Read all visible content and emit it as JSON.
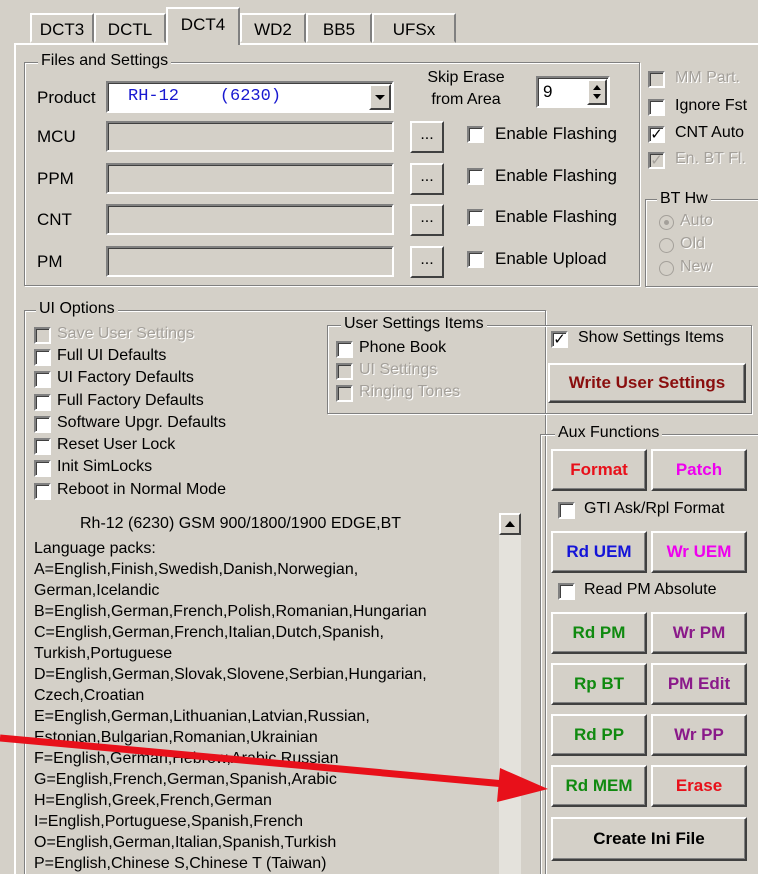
{
  "tabs": [
    "DCT3",
    "DCTL",
    "DCT4",
    "WD2",
    "BB5",
    "UFSx"
  ],
  "active_tab": "DCT4",
  "files": {
    "group_label": "Files and Settings",
    "product_label": "Product",
    "product_value": "RH-12    (6230)",
    "skip_erase_label_1": "Skip Erase",
    "skip_erase_label_2": "from Area",
    "skip_erase_value": "9",
    "browse_label": "...",
    "rows": [
      {
        "label": "MCU",
        "check_label": "Enable Flashing",
        "checked": false
      },
      {
        "label": "PPM",
        "check_label": "Enable Flashing",
        "checked": false
      },
      {
        "label": "CNT",
        "check_label": "Enable Flashing",
        "checked": false
      },
      {
        "label": "PM",
        "check_label": "Enable Upload",
        "checked": false
      }
    ]
  },
  "right_options": [
    {
      "label": "MM Part.",
      "checked": false,
      "disabled": true
    },
    {
      "label": "Ignore Fst",
      "checked": false,
      "disabled": false
    },
    {
      "label": "CNT Auto",
      "checked": true,
      "disabled": false
    },
    {
      "label": "En. BT Fl.",
      "checked": true,
      "disabled": true
    }
  ],
  "bt_hw": {
    "group_label": "BT Hw",
    "options": [
      {
        "label": "Auto",
        "selected": true
      },
      {
        "label": "Old",
        "selected": false
      },
      {
        "label": "New",
        "selected": false
      }
    ]
  },
  "ui_options": {
    "group_label": "UI Options",
    "items": [
      {
        "label": "Save User Settings",
        "disabled": true
      },
      {
        "label": "Full UI Defaults",
        "disabled": false
      },
      {
        "label": "UI Factory Defaults",
        "disabled": false
      },
      {
        "label": "Full Factory Defaults",
        "disabled": false
      },
      {
        "label": "Software Upgr. Defaults",
        "disabled": false
      },
      {
        "label": "Reset User Lock",
        "disabled": false
      },
      {
        "label": "Init SimLocks",
        "disabled": false
      },
      {
        "label": "Reboot in Normal Mode",
        "disabled": false
      }
    ]
  },
  "user_settings": {
    "group_label": "User Settings Items",
    "items": [
      {
        "label": "Phone Book",
        "disabled": false
      },
      {
        "label": "UI Settings",
        "disabled": true
      },
      {
        "label": "Ringing Tones",
        "disabled": true
      }
    ],
    "show_label": "Show Settings Items",
    "show_checked": true,
    "write_button": "Write User Settings"
  },
  "aux": {
    "group_label": "Aux Functions",
    "format": "Format",
    "patch": "Patch",
    "gti_label": "GTI Ask/Rpl Format",
    "rd_uem": "Rd UEM",
    "wr_uem": "Wr UEM",
    "read_pm_abs": "Read PM Absolute",
    "rd_pm": "Rd PM",
    "wr_pm": "Wr PM",
    "rp_bt": "Rp BT",
    "pm_edit": "PM Edit",
    "rd_pp": "Rd PP",
    "wr_pp": "Wr PP",
    "rd_mem": "Rd MEM",
    "erase": "Erase",
    "create_ini": "Create Ini File"
  },
  "info_text": {
    "title": "Rh-12 (6230) GSM 900/1800/1900 EDGE,BT",
    "lines": [
      "Language packs:",
      "A=English,Finish,Swedish,Danish,Norwegian,",
      "German,Icelandic",
      "B=English,German,French,Polish,Romanian,Hungarian",
      "C=English,German,French,Italian,Dutch,Spanish,",
      "Turkish,Portuguese",
      "D=English,German,Slovak,Slovene,Serbian,Hungarian,",
      "Czech,Croatian",
      "E=English,German,Lithuanian,Latvian,Russian,",
      "Estonian,Bulgarian,Romanian,Ukrainian",
      "F=English,German,Hebrew,Arabic,Russian",
      "G=English,French,German,Spanish,Arabic",
      "H=English,Greek,French,German",
      "I=English,Portuguese,Spanish,French",
      "O=English,German,Italian,Spanish,Turkish",
      "P=English,Chinese S,Chinese T (Taiwan)"
    ]
  },
  "colors": {
    "red": "#e8101a",
    "magenta": "#ee00ee",
    "blue": "#1414d8",
    "green": "#108a10",
    "purple": "#8a1a8a",
    "darkred": "#8a0e0e",
    "arrow": "#e8101a"
  }
}
